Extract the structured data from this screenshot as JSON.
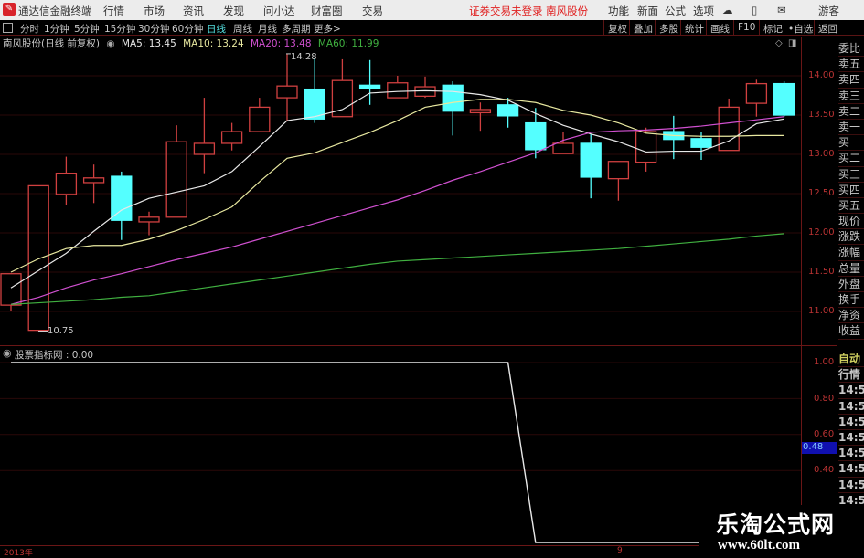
{
  "app": {
    "logo": "通达信",
    "title": "通达信金融终端"
  },
  "menu": [
    "行情",
    "市场",
    "资讯",
    "发现",
    "问小达",
    "财富圈",
    "交易"
  ],
  "status_notice": "证券交易未登录 南风股份",
  "right_menu": [
    "功能",
    "新面",
    "公式",
    "选项"
  ],
  "right_icons": [
    "cloud-icon",
    "phone-icon",
    "message-icon"
  ],
  "user": "游客",
  "periods": [
    "分时",
    "1分钟",
    "5分钟",
    "15分钟",
    "30分钟",
    "60分钟",
    "日线",
    "周线",
    "月线",
    "多周期",
    "更多>"
  ],
  "active_period": "日线",
  "toolbar": [
    "复权",
    "叠加",
    "多股",
    "统计",
    "画线",
    "F10",
    "标记",
    "•自选",
    "返回"
  ],
  "info": {
    "stock": "南风股份(日线 前复权)",
    "ma5": "MA5: 13.45",
    "ma10": "MA10: 13.24",
    "ma20": "MA20: 13.48",
    "ma60": "MA60: 11.99"
  },
  "colors": {
    "up": "#d04040",
    "down": "#54ffff",
    "ma5": "#e8e8e8",
    "ma10": "#e8e8a0",
    "ma20": "#d050d0",
    "ma60": "#40b040",
    "axis": "#b33333",
    "highlight": "#1010b0"
  },
  "chart_data": [
    {
      "type": "candlestick",
      "ylim": [
        10.7,
        14.3
      ],
      "y_ticks": [
        "14.00",
        "13.50",
        "13.00",
        "12.50",
        "12.00",
        "11.50",
        "11.00"
      ],
      "annotations": {
        "high": "14.28",
        "low": "10.75"
      },
      "ohlc": [
        [
          11.08,
          11.48,
          11.01,
          11.48
        ],
        [
          10.76,
          12.6,
          10.75,
          12.6
        ],
        [
          12.49,
          12.97,
          12.35,
          12.76
        ],
        [
          12.64,
          12.87,
          12.38,
          12.7
        ],
        [
          12.72,
          12.78,
          11.91,
          12.16
        ],
        [
          12.14,
          12.27,
          11.97,
          12.2
        ],
        [
          12.2,
          13.37,
          12.2,
          13.16
        ],
        [
          13.0,
          13.72,
          12.76,
          13.14
        ],
        [
          13.14,
          13.4,
          13.05,
          13.29
        ],
        [
          13.29,
          13.72,
          13.29,
          13.6
        ],
        [
          13.72,
          14.28,
          13.42,
          13.87
        ],
        [
          13.83,
          14.23,
          13.4,
          13.45
        ],
        [
          13.48,
          14.21,
          13.48,
          13.94
        ],
        [
          13.88,
          14.2,
          13.63,
          13.84
        ],
        [
          13.72,
          14.0,
          13.72,
          13.91
        ],
        [
          13.74,
          13.99,
          13.72,
          13.86
        ],
        [
          13.88,
          13.93,
          13.24,
          13.55
        ],
        [
          13.53,
          13.66,
          13.3,
          13.57
        ],
        [
          13.63,
          13.72,
          13.34,
          13.49
        ],
        [
          13.4,
          13.59,
          12.95,
          13.06
        ],
        [
          13.01,
          13.28,
          13.01,
          13.14
        ],
        [
          13.14,
          13.26,
          12.44,
          12.71
        ],
        [
          12.69,
          12.91,
          12.41,
          12.91
        ],
        [
          12.9,
          13.34,
          12.78,
          13.29
        ],
        [
          13.29,
          13.49,
          12.94,
          13.19
        ],
        [
          13.2,
          13.29,
          12.93,
          13.09
        ],
        [
          13.05,
          13.71,
          13.05,
          13.6
        ],
        [
          13.65,
          13.95,
          13.48,
          13.9
        ],
        [
          13.9,
          13.93,
          13.48,
          13.5
        ]
      ],
      "series": [
        {
          "name": "MA5",
          "values": [
            11.3,
            11.52,
            11.74,
            12.02,
            12.29,
            12.44,
            12.52,
            12.6,
            12.78,
            13.1,
            13.43,
            13.48,
            13.57,
            13.78,
            13.8,
            13.81,
            13.8,
            13.76,
            13.69,
            13.52,
            13.37,
            13.26,
            13.16,
            13.03,
            13.04,
            13.04,
            13.17,
            13.39,
            13.45
          ]
        },
        {
          "name": "MA10",
          "values": [
            11.5,
            11.67,
            11.8,
            11.84,
            11.84,
            11.92,
            12.03,
            12.17,
            12.33,
            12.65,
            12.95,
            13.02,
            13.15,
            13.28,
            13.43,
            13.6,
            13.66,
            13.7,
            13.7,
            13.66,
            13.56,
            13.5,
            13.4,
            13.27,
            13.24,
            13.23,
            13.23,
            13.24,
            13.24
          ]
        },
        {
          "name": "MA20",
          "values": [
            11.09,
            11.18,
            11.3,
            11.4,
            11.48,
            11.57,
            11.66,
            11.74,
            11.82,
            11.92,
            12.02,
            12.12,
            12.22,
            12.32,
            12.42,
            12.54,
            12.67,
            12.78,
            12.9,
            13.02,
            13.18,
            13.28,
            13.3,
            13.31,
            13.33,
            13.36,
            13.4,
            13.44,
            13.48
          ]
        },
        {
          "name": "MA60",
          "values": [
            11.09,
            11.11,
            11.13,
            11.15,
            11.18,
            11.2,
            11.25,
            11.3,
            11.35,
            11.4,
            11.45,
            11.5,
            11.55,
            11.6,
            11.64,
            11.66,
            11.68,
            11.7,
            11.72,
            11.74,
            11.76,
            11.78,
            11.8,
            11.83,
            11.86,
            11.89,
            11.92,
            11.96,
            11.99
          ]
        }
      ]
    },
    {
      "type": "line",
      "title": "股票指标网 : 0.00",
      "ylim": [
        0,
        1.0
      ],
      "y_ticks": [
        "1.00",
        "0.80",
        "0.60",
        "0.40"
      ],
      "cursor_value": "0.48",
      "values": [
        1,
        1,
        1,
        1,
        1,
        1,
        1,
        1,
        1,
        1,
        1,
        1,
        1,
        1,
        1,
        1,
        1,
        1,
        1,
        0,
        0,
        0,
        0,
        0,
        0,
        0,
        0,
        0,
        0
      ]
    }
  ],
  "x_axis": {
    "labels": [
      "2013年",
      "9"
    ]
  },
  "side_panel": [
    "委比",
    "卖五",
    "卖四",
    "卖三",
    "卖二",
    "卖一",
    "买一",
    "买二",
    "买三",
    "买四",
    "买五",
    "现价",
    "涨跌",
    "涨幅",
    "总量",
    "外盘",
    "换手",
    "净资",
    "收益"
  ],
  "side_panel_lower": [
    "自动",
    "行情",
    "14:5",
    "14:5",
    "14:5",
    "14:5",
    "14:5",
    "14:5",
    "14:5",
    "14:5"
  ],
  "watermark": {
    "title": "乐淘公式网",
    "url": "www.60lt.com"
  }
}
